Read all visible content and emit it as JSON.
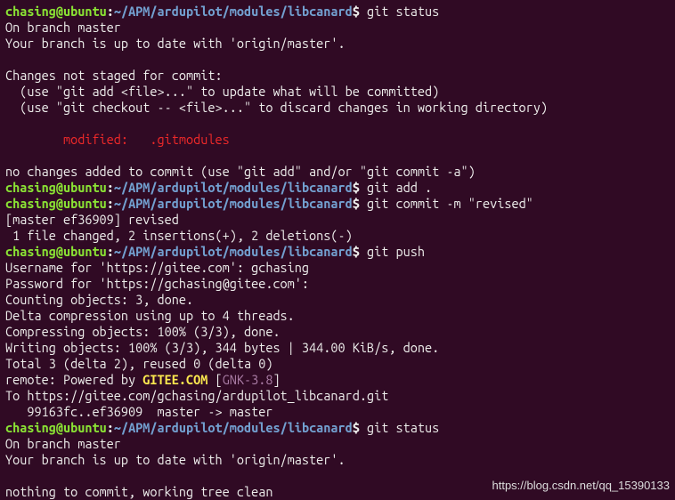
{
  "prompt": {
    "user": "chasing",
    "at": "@",
    "host": "ubuntu",
    "colon": ":",
    "path": "~/APM/ardupilot/modules/libcanard",
    "dollar": "$"
  },
  "blocks": [
    {
      "cmd": "git status",
      "output": [
        {
          "t": "plain",
          "text": "On branch master"
        },
        {
          "t": "plain",
          "text": "Your branch is up to date with 'origin/master'."
        },
        {
          "t": "blank"
        },
        {
          "t": "plain",
          "text": "Changes not staged for commit:"
        },
        {
          "t": "plain",
          "text": "  (use \"git add <file>...\" to update what will be committed)"
        },
        {
          "t": "plain",
          "text": "  (use \"git checkout -- <file>...\" to discard changes in working directory)"
        },
        {
          "t": "blank"
        },
        {
          "t": "red",
          "text": "        modified:   .gitmodules"
        },
        {
          "t": "blank"
        },
        {
          "t": "plain",
          "text": "no changes added to commit (use \"git add\" and/or \"git commit -a\")"
        }
      ]
    },
    {
      "cmd": "git add .",
      "output": []
    },
    {
      "cmd": "git commit -m \"revised\"",
      "output": [
        {
          "t": "plain",
          "text": "[master ef36909] revised"
        },
        {
          "t": "plain",
          "text": " 1 file changed, 2 insertions(+), 2 deletions(-)"
        }
      ]
    },
    {
      "cmd": "git push",
      "output": [
        {
          "t": "plain",
          "text": "Username for 'https://gitee.com': gchasing"
        },
        {
          "t": "plain",
          "text": "Password for 'https://gchasing@gitee.com':"
        },
        {
          "t": "plain",
          "text": "Counting objects: 3, done."
        },
        {
          "t": "plain",
          "text": "Delta compression using up to 4 threads."
        },
        {
          "t": "plain",
          "text": "Compressing objects: 100% (3/3), done."
        },
        {
          "t": "plain",
          "text": "Writing objects: 100% (3/3), 344 bytes | 344.00 KiB/s, done."
        },
        {
          "t": "plain",
          "text": "Total 3 (delta 2), reused 0 (delta 0)"
        },
        {
          "t": "remote",
          "text_a": "remote: Powered by ",
          "text_b": "GITEE.COM",
          "text_c": " [",
          "text_d": "GNK-3.8",
          "text_e": "]"
        },
        {
          "t": "plain",
          "text": "To https://gitee.com/gchasing/ardupilot_libcanard.git"
        },
        {
          "t": "plain",
          "text": "   99163fc..ef36909  master -> master"
        }
      ]
    },
    {
      "cmd": "git status",
      "output": [
        {
          "t": "plain",
          "text": "On branch master"
        },
        {
          "t": "plain",
          "text": "Your branch is up to date with 'origin/master'."
        },
        {
          "t": "blank"
        },
        {
          "t": "plain",
          "text": "nothing to commit, working tree clean"
        }
      ]
    }
  ],
  "watermark": "https://blog.csdn.net/qq_15390133"
}
